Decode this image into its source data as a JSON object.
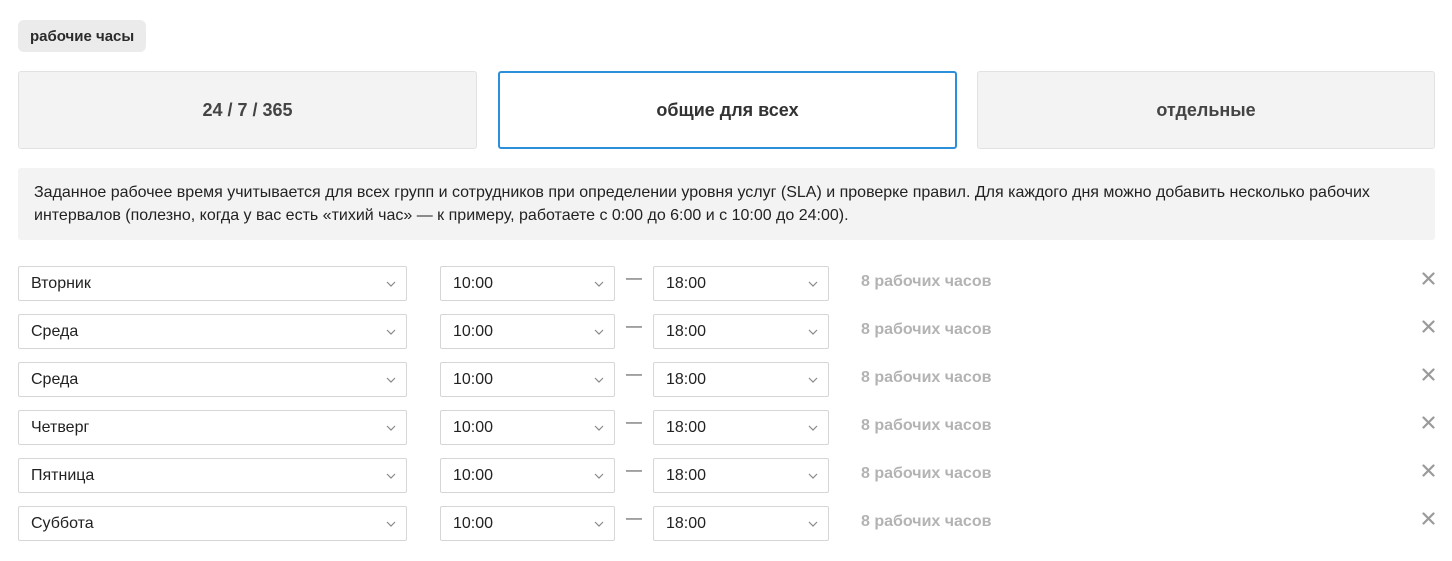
{
  "section_label": "рабочие часы",
  "modes": [
    {
      "label": "24 / 7 / 365",
      "selected": false
    },
    {
      "label": "общие для всех",
      "selected": true
    },
    {
      "label": "отдельные",
      "selected": false
    }
  ],
  "info_text": "Заданное рабочее время учитывается для всех групп и сотрудников при определении уровня услуг (SLA) и проверке правил. Для каждого дня можно добавить несколько рабочих интервалов (полезно, когда у вас есть «тихий час» — к примеру, работаете с 0:00 до 6:00 и с 10:00 до 24:00).",
  "separator": "—",
  "rows": [
    {
      "day": "Вторник",
      "from": "10:00",
      "to": "18:00",
      "hours": "8 рабочих часов"
    },
    {
      "day": "Среда",
      "from": "10:00",
      "to": "18:00",
      "hours": "8 рабочих часов"
    },
    {
      "day": "Среда",
      "from": "10:00",
      "to": "18:00",
      "hours": "8 рабочих часов"
    },
    {
      "day": "Четверг",
      "from": "10:00",
      "to": "18:00",
      "hours": "8 рабочих часов"
    },
    {
      "day": "Пятница",
      "from": "10:00",
      "to": "18:00",
      "hours": "8 рабочих часов"
    },
    {
      "day": "Суббота",
      "from": "10:00",
      "to": "18:00",
      "hours": "8 рабочих часов"
    }
  ],
  "icons": {
    "dropdown": "chevron-down-icon",
    "remove": "close-icon"
  },
  "colors": {
    "accent": "#2b8fd9",
    "muted_text": "#b3b3b3",
    "panel_bg": "#f3f3f3"
  }
}
